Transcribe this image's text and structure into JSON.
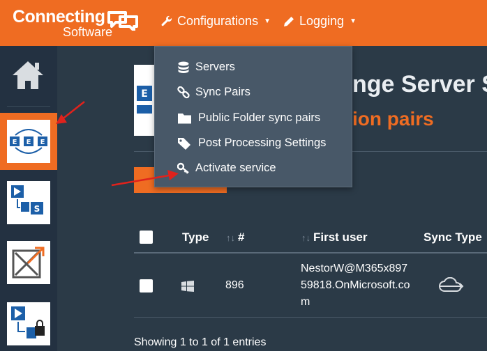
{
  "brand": {
    "name_line1": "Connecting",
    "name_line2": "Software"
  },
  "topnav": {
    "configurations": "Configurations",
    "logging": "Logging"
  },
  "dropdown": {
    "items": [
      {
        "label": "Servers",
        "icon": "database-icon"
      },
      {
        "label": "Sync Pairs",
        "icon": "link-icon"
      },
      {
        "label": "Public Folder sync pairs",
        "icon": "folder-icon"
      },
      {
        "label": "Post Processing Settings",
        "icon": "tag-icon"
      },
      {
        "label": "Activate service",
        "icon": "key-icon"
      }
    ]
  },
  "page": {
    "title": "nge Server S",
    "subtitle": "ion pairs"
  },
  "table": {
    "headers": {
      "type": "Type",
      "id": "#",
      "first_user": "First user",
      "sync_type": "Sync Type"
    },
    "rows": [
      {
        "type_icon": "windows-icon",
        "id": "896",
        "first_user": "NestorW@M365x89759818.OnMicrosoft.com",
        "sync_type_icon": "cloud-sync-icon"
      }
    ]
  },
  "footer": {
    "entries": "Showing 1 to 1 of 1 entries"
  },
  "colors": {
    "accent": "#ef6c22",
    "background": "#2b3a47",
    "sidebar": "#233141",
    "dropdown": "#485868",
    "annotation_arrow": "#e0221c"
  }
}
